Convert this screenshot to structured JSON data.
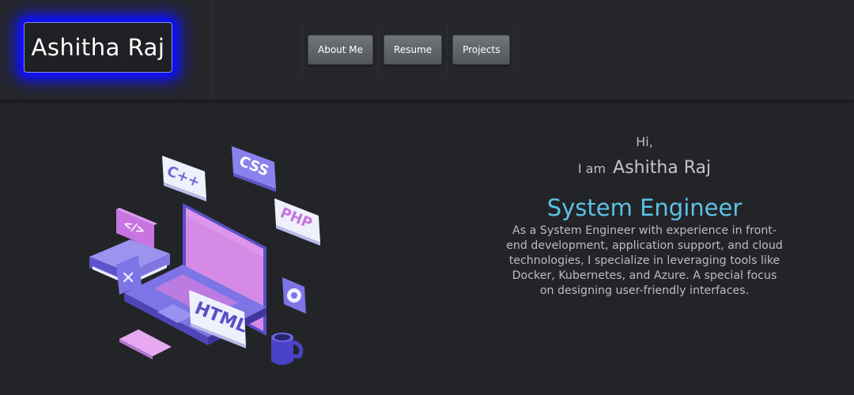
{
  "header": {
    "logo_text": "Ashitha Raj",
    "nav": [
      {
        "label": "About Me"
      },
      {
        "label": "Resume"
      },
      {
        "label": "Projects"
      }
    ]
  },
  "hero": {
    "greeting": "Hi,",
    "iam": "I am",
    "name": "Ashitha Raj",
    "role": "System Engineer",
    "bio": "As a System Engineer with experience in front-end development, application support, and cloud technologies, I specialize in leveraging tools like Docker, Kubernetes, and Azure. A special focus on designing user-friendly interfaces."
  },
  "illustration": {
    "tags": [
      "C++",
      "CSS",
      "PHP",
      "</>",
      "HTML"
    ],
    "icons": [
      "laptop-icon",
      "book-stack-icon",
      "close-icon",
      "gear-icon",
      "mug-icon",
      "phone-icon"
    ]
  },
  "colors": {
    "background": "#232428",
    "header": "#26272b",
    "logo_glow": "#0b10ff",
    "accent_role": "#5cc2e6",
    "nav_button": "#63676c",
    "illustration_purple": "#7d74e6",
    "illustration_pink": "#d58be6"
  }
}
